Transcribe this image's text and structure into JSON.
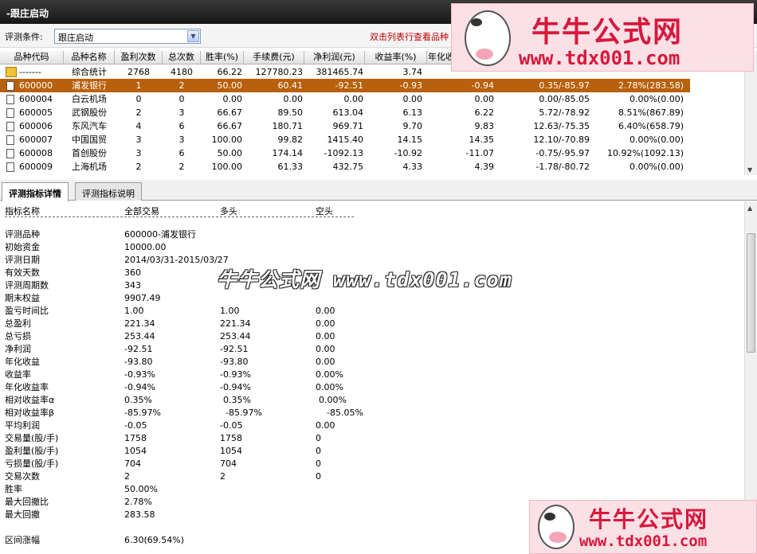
{
  "window": {
    "title": "-跟庄启动"
  },
  "filter": {
    "label": "评测条件:",
    "selected": "跟庄启动",
    "hint": "双击列表行查看品种"
  },
  "grid": {
    "columns": [
      "品种代码",
      "品种名称",
      "盈利次数",
      "总次数",
      "胜率(%)",
      "手续费(元)",
      "净利润(元)",
      "收益率(%)",
      "年化收"
    ],
    "rows": [
      [
        "-------",
        "综合统计",
        "2768",
        "4180",
        "66.22",
        "127780.23",
        "381465.74",
        "3.74",
        "",
        "",
        ""
      ],
      [
        "600000",
        "浦发银行",
        "1",
        "2",
        "50.00",
        "60.41",
        "-92.51",
        "-0.93",
        "-0.94",
        "0.35/-85.97",
        "2.78%(283.58)"
      ],
      [
        "600004",
        "白云机场",
        "0",
        "0",
        "0.00",
        "0.00",
        "0.00",
        "0.00",
        "0.00",
        "0.00/-85.05",
        "0.00%(0.00)"
      ],
      [
        "600005",
        "武钢股份",
        "2",
        "3",
        "66.67",
        "89.50",
        "613.04",
        "6.13",
        "6.22",
        "5.72/-78.92",
        "8.51%(867.89)"
      ],
      [
        "600006",
        "东风汽车",
        "4",
        "6",
        "66.67",
        "180.71",
        "969.71",
        "9.70",
        "9.83",
        "12.63/-75.35",
        "6.40%(658.79)"
      ],
      [
        "600007",
        "中国国贸",
        "3",
        "3",
        "100.00",
        "99.82",
        "1415.40",
        "14.15",
        "14.35",
        "12.10/-70.89",
        "0.00%(0.00)"
      ],
      [
        "600008",
        "首创股份",
        "3",
        "6",
        "50.00",
        "174.14",
        "-1092.13",
        "-10.92",
        "-11.07",
        "-0.75/-95.97",
        "10.92%(1092.13)"
      ],
      [
        "600009",
        "上海机场",
        "2",
        "2",
        "100.00",
        "61.33",
        "432.75",
        "4.33",
        "4.39",
        "-1.78/-80.72",
        "0.00%(0.00)"
      ]
    ]
  },
  "tabs": [
    {
      "label": "评测指标详情",
      "active": true
    },
    {
      "label": "评测指标说明",
      "active": false
    }
  ],
  "detail": {
    "headers": [
      "指标名称",
      "全部交易",
      "多头",
      "空头"
    ],
    "rows": [
      [
        "评测品种",
        "600000-浦发银行",
        "",
        ""
      ],
      [
        "初始资金",
        "10000.00",
        "",
        ""
      ],
      [
        "评测日期",
        "2014/03/31-2015/03/27",
        "",
        ""
      ],
      [
        "有效天数",
        "360",
        "",
        ""
      ],
      [
        "评测周期数",
        "343",
        "",
        ""
      ],
      [
        "期末权益",
        "9907.49",
        "",
        ""
      ],
      [
        "盈亏时间比",
        "1.00",
        "1.00",
        "0.00"
      ],
      [
        "总盈利",
        "221.34",
        "221.34",
        "0.00"
      ],
      [
        "总亏损",
        "253.44",
        "253.44",
        "0.00"
      ],
      [
        "净利润",
        "-92.51",
        "-92.51",
        "0.00"
      ],
      [
        "年化收益",
        "-93.80",
        "-93.80",
        "0.00"
      ],
      [
        "收益率",
        "-0.93%",
        "-0.93%",
        "0.00%"
      ],
      [
        "年化收益率",
        "-0.94%",
        "-0.94%",
        "0.00%"
      ],
      [
        "相对收益率α",
        "0.35%",
        "0.35%",
        "0.00%"
      ],
      [
        "相对收益率β",
        "-85.97%",
        "-85.97%",
        "-85.05%"
      ],
      [
        "平均利润",
        "-0.05",
        "-0.05",
        "0.00"
      ],
      [
        "交易量(股/手)",
        "1758",
        "1758",
        "0"
      ],
      [
        "盈利量(股/手)",
        "1054",
        "1054",
        "0"
      ],
      [
        "亏损量(股/手)",
        "704",
        "704",
        "0"
      ],
      [
        "交易次数",
        "2",
        "2",
        "0"
      ],
      [
        "胜率",
        "50.00%",
        "",
        ""
      ],
      [
        "最大回撤比",
        "2.78%",
        "",
        ""
      ],
      [
        "最大回撤",
        "283.58",
        "",
        ""
      ],
      [
        "",
        ""
      ],
      [
        "区间涨幅",
        "6.30(69.54%)",
        "",
        ""
      ]
    ]
  },
  "watermark": {
    "title": "牛牛公式网",
    "url": "www.tdx001.com",
    "mid": "牛牛公式网 www.tdx001.com"
  },
  "colors": {
    "selected_row": "#b9600c",
    "hint": "#c00000",
    "watermark": "#d8183c"
  }
}
